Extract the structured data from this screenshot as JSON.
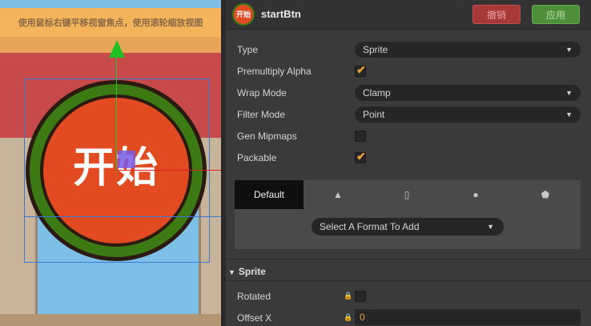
{
  "scene": {
    "hint_text": "使用鼠标右键平移视窗焦点，使用滚轮缩放视图",
    "button_text": "开始"
  },
  "inspector": {
    "asset_name": "startBtn",
    "asset_icon": "start-button-thumbnail",
    "thumbnail_text": "开始",
    "revert_label": "撤销",
    "apply_label": "应用",
    "colors": {
      "revert": "#a93838",
      "apply": "#4e8f3b",
      "accent": "#f0a030"
    },
    "properties": {
      "type_label": "Type",
      "type_value": "Sprite",
      "premultiply_label": "Premultiply Alpha",
      "premultiply_checked": true,
      "wrap_label": "Wrap Mode",
      "wrap_value": "Clamp",
      "filter_label": "Filter Mode",
      "filter_value": "Point",
      "mipmaps_label": "Gen Mipmaps",
      "mipmaps_checked": false,
      "packable_label": "Packable",
      "packable_checked": true
    },
    "platform_tabs": [
      {
        "label": "Default",
        "icon": "default"
      },
      {
        "label": "",
        "icon": "android-icon"
      },
      {
        "label": "",
        "icon": "mobile-icon"
      },
      {
        "label": "",
        "icon": "wechat-icon"
      },
      {
        "label": "",
        "icon": "html5-icon"
      }
    ],
    "format_select_placeholder": "Select A Format To Add",
    "sprite_section": {
      "title": "Sprite",
      "rotated_label": "Rotated",
      "rotated_checked": false,
      "offset_x_label": "Offset X",
      "offset_x_value": "0"
    }
  }
}
